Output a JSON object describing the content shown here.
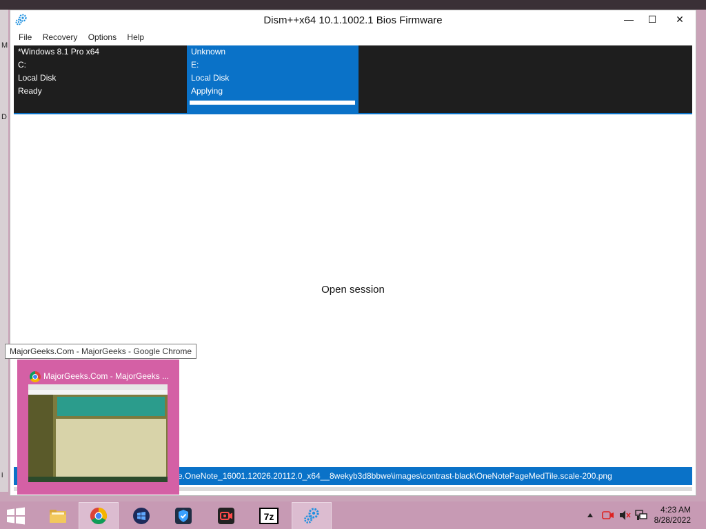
{
  "window": {
    "title": "Dism++x64 10.1.1002.1 Bios Firmware",
    "controls": {
      "minimize": "—",
      "maximize": "☐",
      "close": "✕"
    }
  },
  "menu": [
    "File",
    "Recovery",
    "Options",
    "Help"
  ],
  "sessions": [
    {
      "name": "*Windows 8.1 Pro x64",
      "drive": "C:",
      "disk": "Local Disk",
      "status": "Ready"
    },
    {
      "name": "Unknown",
      "drive": "E:",
      "disk": "Local Disk",
      "status": "Applying",
      "progress_percent": 100
    }
  ],
  "content": {
    "message": "Open session"
  },
  "statusbar": {
    "text": "e.OneNote_16001.12026.20112.0_x64__8wekyb3d8bbwe\\images\\contrast-black\\OneNotePageMedTile.scale-200.png"
  },
  "desktop_left_letters": [
    "M",
    "D",
    "i"
  ],
  "tooltip": {
    "text": "MajorGeeks.Com - MajorGeeks - Google Chrome"
  },
  "thumbnail": {
    "title": "MajorGeeks.Com - MajorGeeks ..."
  },
  "taskbar": {
    "items": [
      {
        "name": "file-explorer",
        "icon": "folder-icon"
      },
      {
        "name": "chrome",
        "icon": "chrome-icon"
      },
      {
        "name": "windows-security",
        "icon": "shield-window-icon"
      },
      {
        "name": "vpn",
        "icon": "shield-check-icon"
      },
      {
        "name": "screen-recorder",
        "icon": "camera-record-icon"
      },
      {
        "name": "7zip",
        "icon": "7z-icon",
        "label": "7z"
      },
      {
        "name": "dism",
        "icon": "gears-icon"
      }
    ],
    "clock": {
      "time": "4:23 AM",
      "date": "8/28/2022"
    }
  },
  "colors": {
    "accent": "#0a72c8",
    "session_bg": "#1e1e1e",
    "taskbar": "#c79ab4",
    "thumbnail": "#d460a5"
  }
}
